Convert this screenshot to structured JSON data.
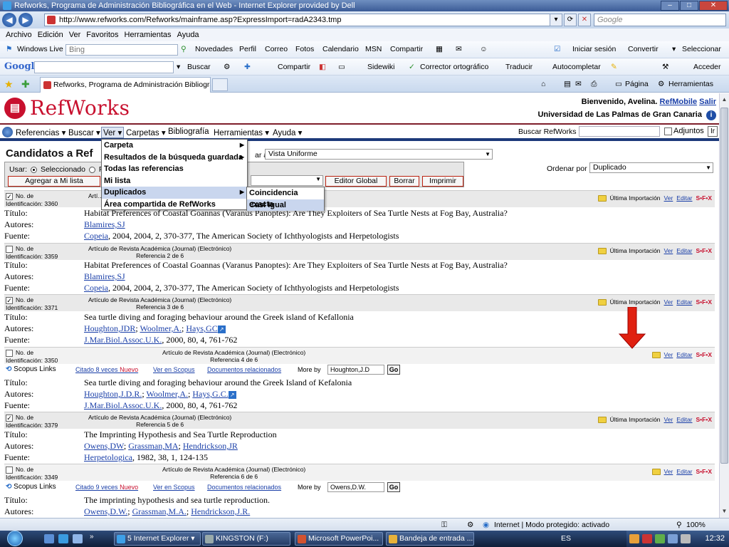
{
  "window": {
    "title": "Refworks, Programa de Administración Bibliográfica en el Web - Internet Explorer provided by Dell",
    "url": "http://www.refworks.com/Refworks/mainframe.asp?ExpressImport=radA2343.tmp",
    "search_placeholder": "Google",
    "tab_title": "Refworks, Programa de Administración Bibliográf...",
    "menu": [
      "Archivo",
      "Edición",
      "Ver",
      "Favoritos",
      "Herramientas",
      "Ayuda"
    ]
  },
  "windows_live_bar": {
    "brand": "Windows Live",
    "search_value": "Bing",
    "items": [
      "Novedades",
      "Perfil",
      "Correo",
      "Fotos",
      "Calendario",
      "MSN",
      "Compartir"
    ],
    "signin": "Iniciar sesión",
    "convert": "Convertir",
    "select": "Seleccionar"
  },
  "google_bar": {
    "logo": "Google",
    "items": [
      "Buscar",
      "Compartir",
      "Sidewiki",
      "Corrector ortográfico",
      "Traducir",
      "Autocompletar"
    ],
    "login": "Acceder"
  },
  "tab_bar": {
    "page": "Página",
    "tools": "Herramientas"
  },
  "refworks": {
    "logo_text": "RefWorks",
    "welcome": "Bienvenido, Avelina.",
    "refmobile": "RefMobile",
    "exit": "Salir",
    "institution": "Universidad de Las Palmas de Gran Canaria",
    "nav": [
      "Referencias",
      "Buscar",
      "Ver",
      "Carpetas",
      "Bibliografía",
      "Herramientas",
      "Ayuda"
    ],
    "search_label": "Buscar RefWorks",
    "adjuntos": "Adjuntos",
    "page_title": "Candidatos a Ref",
    "view_label": "ar a:",
    "view_value": "Vista Uniforme",
    "usar_label": "Usar:",
    "usar_selected": "Seleccionado",
    "usar_p": "P",
    "add_to_list": "Agregar a Mi lista",
    "p_label": "P",
    "editor_global": "Editor Global",
    "delete": "Borrar",
    "print": "Imprimir",
    "sort_label": "Ordenar  por",
    "sort_value": "Duplicado",
    "ver_menu": [
      "Carpeta",
      "Resultados de la búsqueda guardada",
      "Todas las referencias",
      "Mi lista",
      "Duplicados",
      "Área compartida de RefWorks"
    ],
    "dup_menu": [
      "Coincidencia exacta",
      "Casi Igual"
    ]
  },
  "labels": {
    "no_de": "No. de",
    "identificacion": "Identificación:",
    "titulo": "Título:",
    "autores": "Autores:",
    "fuente": "Fuente:",
    "ver": "Ver",
    "editar": "Editar",
    "ultima": "Última Importación",
    "sfx": "S•F•X",
    "scopus": "Scopus Links",
    "more_by": "More by",
    "go": "Go",
    "ver_scopus": "Ver en Scopus",
    "docs": "Documentos relacionados"
  },
  "records": [
    {
      "id": "3360",
      "checked": true,
      "type": "Artículo de Revista Académica (Journal) (Electrónico)",
      "ref": "Referencia 1 de 6",
      "ultima": true,
      "title": "Habitat Preferences of Coastal Goannas (Varanus Panoptes): Are They Exploiters of Sea Turtle Nests at Fog Bay, Australia?",
      "authors": [
        "Blamires,SJ"
      ],
      "source_link": "Copeia",
      "source_rest": ", 2004, 2004, 2, 370-377, The American Society of Ichthyologists and Herpetologists"
    },
    {
      "id": "3359",
      "checked": false,
      "type": "Artículo de Revista Académica (Journal) (Electrónico)",
      "ref": "Referencia 2 de 6",
      "ultima": true,
      "title": "Habitat Preferences of Coastal Goannas (Varanus Panoptes): Are They Exploiters of Sea Turtle Nests at Fog Bay, Australia?",
      "authors": [
        "Blamires,SJ"
      ],
      "source_link": "Copeia",
      "source_rest": ", 2004, 2004, 2, 370-377, The American Society of Ichthyologists and Herpetologists"
    },
    {
      "id": "3371",
      "checked": true,
      "type": "Artículo de Revista Académica (Journal) (Electrónico)",
      "ref": "Referencia 3 de 6",
      "ultima": true,
      "title": "Sea turtle diving and foraging behaviour around the Greek island of Kefallonia",
      "authors": [
        "Houghton,JDR",
        "Woolmer,A.",
        "Hays,GC"
      ],
      "source_link": "J.Mar.Biol.Assoc.U.K.",
      "source_rest": ", 2000, 80, 4, 761-762"
    },
    {
      "id": "3350",
      "checked": false,
      "type": "Artículo de Revista Académica (Journal) (Electrónico)",
      "ref": "Referencia 4 de 6",
      "ultima": false,
      "scopus": {
        "cited": "Citado 8 veces",
        "nuevo": "Nuevo",
        "more_by": "Houghton,J.D"
      },
      "title": "Sea turtle diving and foraging behaviour around the Greek Island of Kefalonia",
      "authors": [
        "Houghton,J.D.R.",
        "Woolmer,A.",
        "Hays,G.C."
      ],
      "source_link": "J.Mar.Biol.Assoc.U.K.",
      "source_rest": ", 2000, 80, 4, 761-762"
    },
    {
      "id": "3379",
      "checked": true,
      "type": "Artículo de Revista Académica (Journal) (Electrónico)",
      "ref": "Referencia 5 de 6",
      "ultima": true,
      "title": "The Imprinting Hypothesis and Sea Turtle Reproduction",
      "authors": [
        "Owens,DW",
        "Grassman,MA",
        "Hendrickson,JR"
      ],
      "source_link": "Herpetologica",
      "source_rest": ", 1982, 38, 1, 124-135"
    },
    {
      "id": "3349",
      "checked": false,
      "type": "Artículo de Revista Académica (Journal) (Electrónico)",
      "ref": "Referencia 6 de 6",
      "ultima": false,
      "scopus": {
        "cited": "Citado 9 veces",
        "nuevo": "Nuevo",
        "more_by": "Owens,D.W."
      },
      "title": "The imprinting hypothesis and sea turtle reproduction.",
      "authors": [
        "Owens,D.W.",
        "Grassman,M.A.",
        "Hendrickson,J.R."
      ]
    }
  ],
  "status": {
    "internet": "Internet | Modo protegido: activado",
    "zoom": "100%"
  },
  "taskbar": {
    "buttons": [
      "5 Internet Explorer",
      "KINGSTON (F:)",
      "Microsoft PowerPoi...",
      "Bandeja de entrada ..."
    ],
    "lang": "ES",
    "clock": "12:32"
  }
}
